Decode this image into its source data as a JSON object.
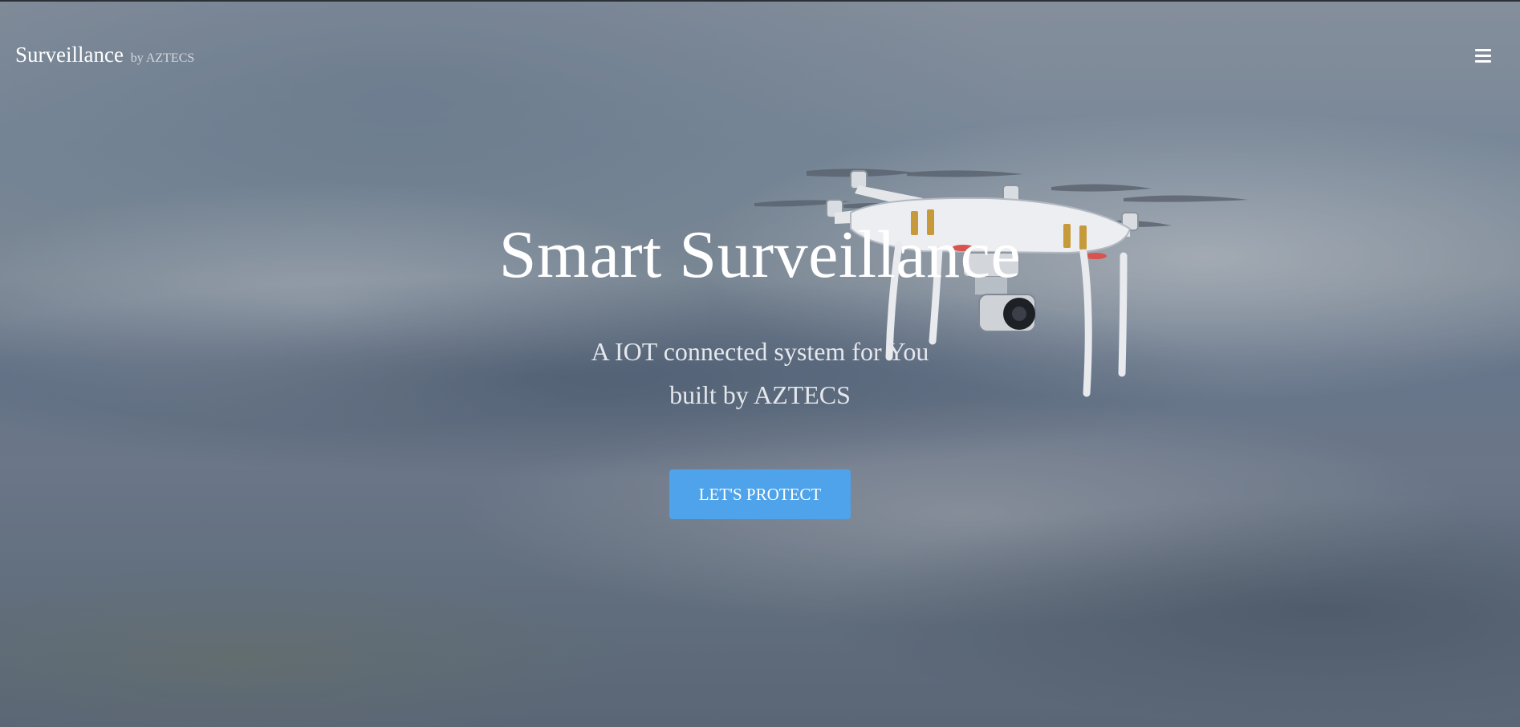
{
  "navbar": {
    "brand_title": "Surveillance",
    "brand_subtitle": "by AZTECS",
    "menu_icon": "hamburger-menu-icon"
  },
  "hero": {
    "title": "Smart Surveillance",
    "subtitle_line1": "A IOT connected system for You",
    "subtitle_line2": "built by AZTECS",
    "cta_label": "LET'S PROTECT"
  },
  "colors": {
    "cta_background": "#4ea3ea",
    "text": "#ffffff"
  }
}
